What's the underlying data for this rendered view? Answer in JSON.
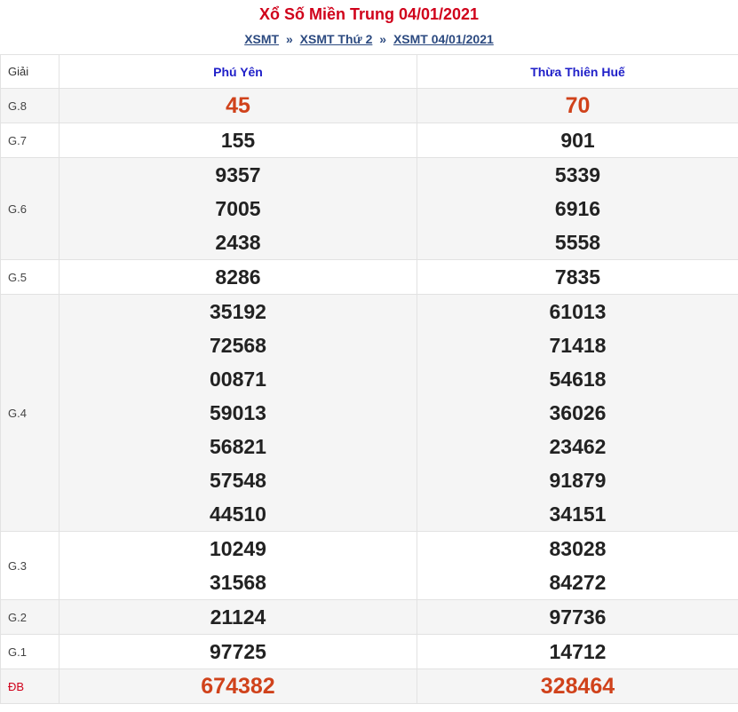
{
  "title": "Xổ Số Miền Trung 04/01/2021",
  "breadcrumb": [
    {
      "label": "XSMT"
    },
    {
      "label": "XSMT Thứ 2"
    },
    {
      "label": "XSMT 04/01/2021"
    }
  ],
  "breadcrumb_sep": "»",
  "table": {
    "header": {
      "giai": "Giải",
      "col1": "Phú Yên",
      "col2": "Thừa Thiên Huế"
    },
    "rows": [
      {
        "giai": "G.8",
        "col1": [
          "45"
        ],
        "col2": [
          "70"
        ]
      },
      {
        "giai": "G.7",
        "col1": [
          "155"
        ],
        "col2": [
          "901"
        ]
      },
      {
        "giai": "G.6",
        "col1": [
          "9357",
          "7005",
          "2438"
        ],
        "col2": [
          "5339",
          "6916",
          "5558"
        ]
      },
      {
        "giai": "G.5",
        "col1": [
          "8286"
        ],
        "col2": [
          "7835"
        ]
      },
      {
        "giai": "G.4",
        "col1": [
          "35192",
          "72568",
          "00871",
          "59013",
          "56821",
          "57548",
          "44510"
        ],
        "col2": [
          "61013",
          "71418",
          "54618",
          "36026",
          "23462",
          "91879",
          "34151"
        ]
      },
      {
        "giai": "G.3",
        "col1": [
          "10249",
          "31568"
        ],
        "col2": [
          "83028",
          "84272"
        ]
      },
      {
        "giai": "G.2",
        "col1": [
          "21124"
        ],
        "col2": [
          "97736"
        ]
      },
      {
        "giai": "G.1",
        "col1": [
          "97725"
        ],
        "col2": [
          "14712"
        ]
      },
      {
        "giai": "ĐB",
        "col1": [
          "674382"
        ],
        "col2": [
          "328464"
        ]
      }
    ]
  },
  "colors": {
    "title": "#d0021b",
    "header_text": "#1e1ec8",
    "highlight_number": "#d0421b",
    "link": "#2c4a80"
  }
}
